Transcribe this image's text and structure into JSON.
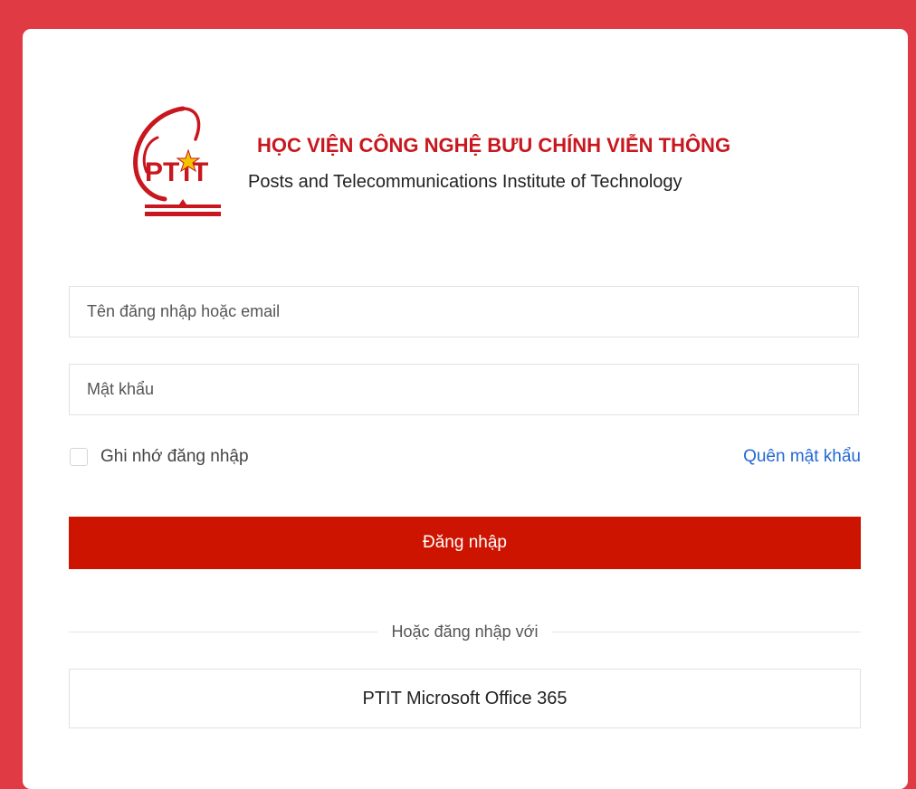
{
  "brand": {
    "logo_icon": "ptit-logo",
    "logo_text": "PTIT",
    "title": "HỌC VIỆN CÔNG NGHỆ BƯU CHÍNH VIỄN THÔNG",
    "subtitle": "Posts and Telecommunications Institute of Technology",
    "accent_color": "#c8171e"
  },
  "form": {
    "username_placeholder": "Tên đăng nhập hoặc email",
    "username_value": "",
    "password_placeholder": "Mật khẩu",
    "password_value": "",
    "remember_label": "Ghi nhớ đăng nhập",
    "remember_checked": false,
    "forgot_label": "Quên mật khẩu",
    "submit_label": "Đăng nhập",
    "submit_color": "#cc1400"
  },
  "alternate": {
    "divider_text": "Hoặc đăng nhập với",
    "office_button_label": "PTIT Microsoft Office 365"
  },
  "colors": {
    "page_background": "#e03a45",
    "link": "#2569d0"
  }
}
